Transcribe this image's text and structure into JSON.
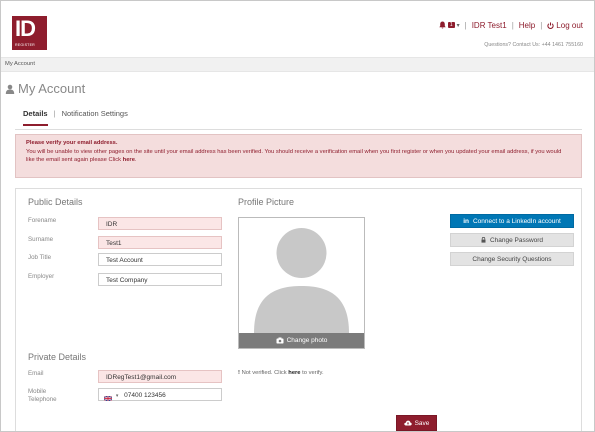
{
  "header": {
    "logo_text": "ID",
    "logo_subtext": "REGISTER",
    "notification_count": "1",
    "user_name": "IDR Test1",
    "help_label": "Help",
    "logout_label": "Log out",
    "contact_text": "Questions? Contact Us: +44 1461 755160"
  },
  "breadcrumb": {
    "label": "My Account"
  },
  "page": {
    "title": "My Account",
    "tabs": [
      {
        "label": "Details",
        "active": true
      },
      {
        "label": "Notification Settings",
        "active": false
      }
    ]
  },
  "alert": {
    "heading": "Please verify your email address.",
    "body_prefix": "You will be unable to view other pages on the site until your email address has been verified. You should receive a verification email when you first register or when you updated your email address, if you would like the email sent again please Click ",
    "body_link": "here",
    "body_suffix": "."
  },
  "public_details": {
    "heading": "Public Details",
    "fields": [
      {
        "label": "Forename",
        "value": "IDR",
        "error": true
      },
      {
        "label": "Surname",
        "value": "Test1",
        "error": true
      },
      {
        "label": "Job Title",
        "value": "Test Account",
        "error": false
      },
      {
        "label": "Employer",
        "value": "Test Company",
        "error": false
      }
    ]
  },
  "profile_picture": {
    "heading": "Profile Picture",
    "change_photo_label": "Change photo"
  },
  "actions": {
    "linkedin_label": "Connect to a LinkedIn account",
    "change_password_label": "Change Password",
    "security_questions_label": "Change Security Questions"
  },
  "private_details": {
    "heading": "Private Details",
    "email_label": "Email",
    "email_value": "IDRegTest1@gmail.com",
    "mobile_label": "Mobile Telephone",
    "mobile_value": "07400 123456",
    "verify_prefix": "Not verified. Click ",
    "verify_link": "here",
    "verify_suffix": " to verify."
  },
  "save_label": "Save",
  "colors": {
    "brand": "#8e1d2d",
    "linkedin": "#0077b5",
    "alert_bg": "#f4dddd"
  }
}
